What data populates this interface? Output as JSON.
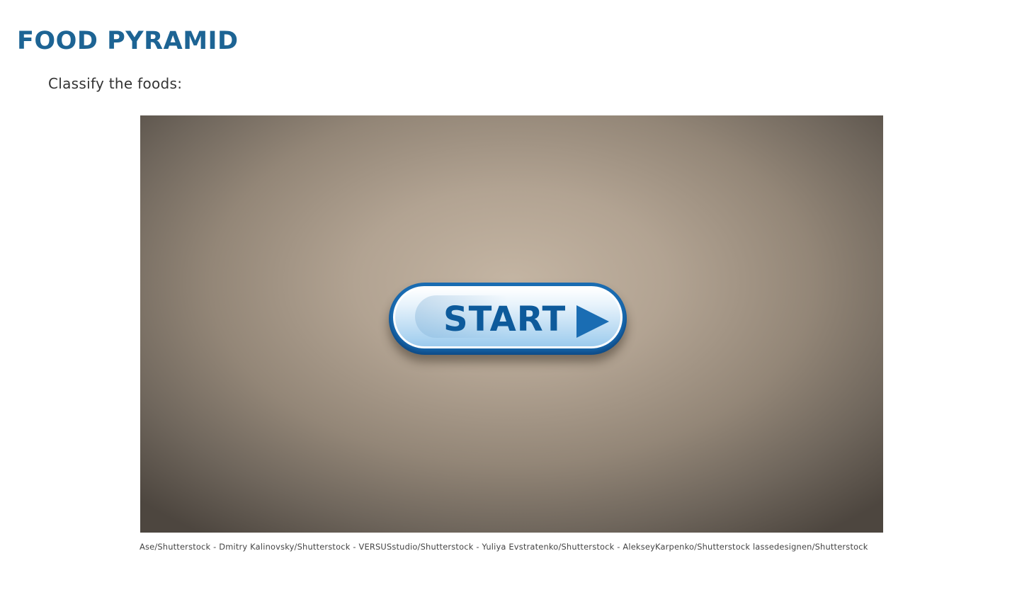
{
  "header": {
    "title": "FOOD PYRAMID",
    "instruction": "Classify the foods:"
  },
  "activity": {
    "start_label": "START",
    "start_icon": "play-icon",
    "colors": {
      "title": "#1d6494",
      "button_border": "#1a6db3",
      "button_text": "#0d5a9b",
      "stage_center": "#c4b5a3",
      "stage_edge": "#4d463f"
    }
  },
  "footer": {
    "credits": "Ase/Shutterstock - Dmitry Kalinovsky/Shutterstock - VERSUSstudio/Shutterstock - Yuliya Evstratenko/Shutterstock - AlekseyKarpenko/Shutterstock lassedesignen/Shutterstock"
  }
}
